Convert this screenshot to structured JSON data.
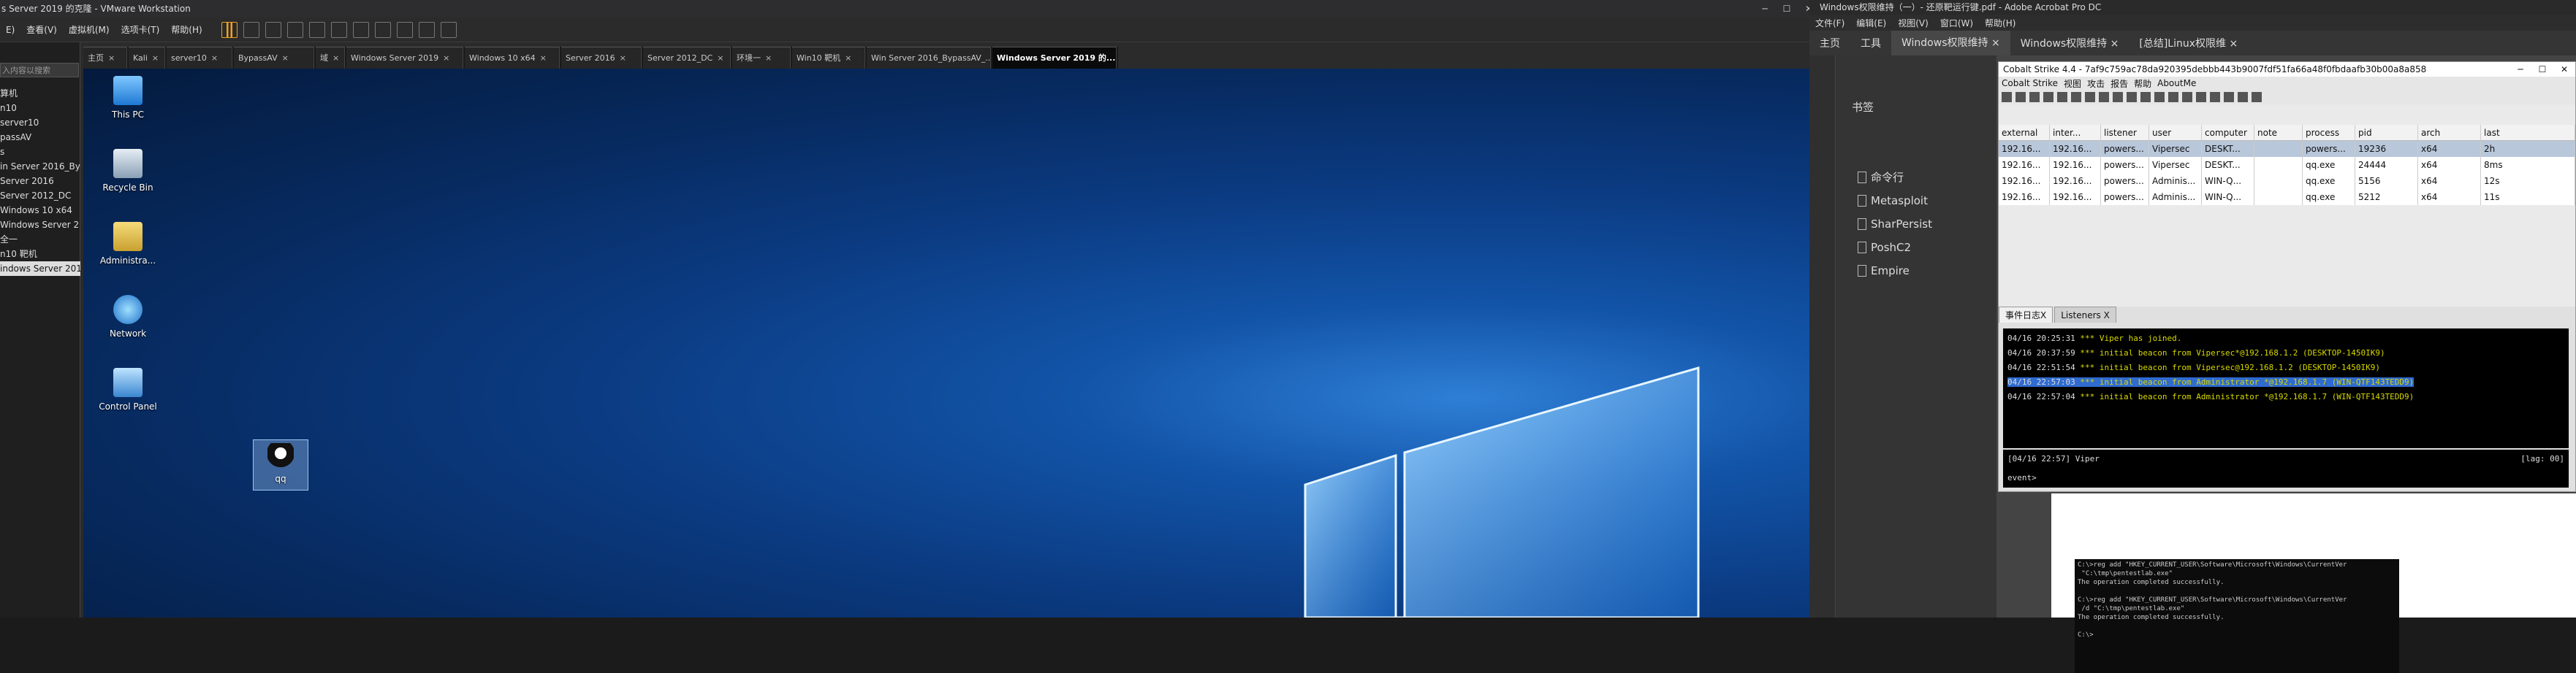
{
  "vmware": {
    "title": "s Server 2019 的克隆 - VMware Workstation",
    "menu": [
      "E)",
      "查看(V)",
      "虚拟机(M)",
      "选项卡(T)",
      "帮助(H)"
    ],
    "library_search_placeholder": "入内容以搜索",
    "library": [
      "算机",
      "n10",
      "server10",
      "passAV",
      "s",
      "in Server 2016_Bypa",
      "Server 2016",
      "Server 2012_DC",
      "Windows 10 x64",
      "Windows Server 2",
      "全一",
      "n10 靶机",
      "indows Server 2019"
    ],
    "library_selected": 12,
    "tabs": [
      "主页",
      "Kali",
      "server10",
      "BypassAV",
      "域",
      "Windows Server 2019",
      "Windows 10 x64",
      "Server 2016",
      "Server 2012_DC",
      "环境一",
      "Win10 靶机",
      "Win Server 2016_BypassAV_...",
      "Windows Server 2019 的..."
    ],
    "active_tab": 12,
    "desktop_icons": [
      "This PC",
      "Recycle Bin",
      "Administra...",
      "Network",
      "Control Panel",
      "qq"
    ]
  },
  "acrobat": {
    "title": "Windows权限维持（一）- 还原靶运行键.pdf - Adobe Acrobat Pro DC",
    "menu": [
      "文件(F)",
      "编辑(E)",
      "视图(V)",
      "窗口(W)",
      "帮助(H)"
    ],
    "tabs": [
      "主页",
      "工具",
      "Windows权限维持 ×",
      "Windows权限维持 ×",
      "[总结]Linux权限维 ×"
    ],
    "bookmarks_title": "书签",
    "bookmarks": [
      "命令行",
      "Metasploit",
      "SharPersist",
      "PoshC2",
      "Empire"
    ],
    "cmd_output": "C:\\>reg add \"HKEY_CURRENT_USER\\Software\\Microsoft\\Windows\\CurrentVer\n \"C:\\tmp\\pentestlab.exe\"\nThe operation completed successfully.\n\nC:\\>reg add \"HKEY_CURRENT_USER\\Software\\Microsoft\\Windows\\CurrentVer\n /d \"C:\\tmp\\pentestlab.exe\"\nThe operation completed successfully.\n\nC:\\>"
  },
  "cobalt": {
    "title": "Cobalt Strike 4.4 - 7af9c759ac78da920395debbb443b9007fdf51fa66a48f0fbdaafb30b00a8a858",
    "menu": [
      "Cobalt Strike",
      "视图",
      "攻击",
      "报告",
      "帮助",
      "AboutMe"
    ],
    "columns": [
      "external",
      "inter...",
      "listener",
      "user",
      "computer",
      "note",
      "process",
      "pid",
      "arch",
      "last"
    ],
    "rows": [
      [
        "192.16...",
        "192.16...",
        "powers...",
        "Vipersec",
        "DESKT...",
        "",
        "powers...",
        "19236",
        "x64",
        "2h"
      ],
      [
        "192.16...",
        "192.16...",
        "powers...",
        "Vipersec",
        "DESKT...",
        "",
        "qq.exe",
        "24444",
        "x64",
        "8ms"
      ],
      [
        "192.16...",
        "192.16...",
        "powers...",
        "Adminis...",
        "WIN-Q...",
        "",
        "qq.exe",
        "5156",
        "x64",
        "12s"
      ],
      [
        "192.16...",
        "192.16...",
        "powers...",
        "Adminis...",
        "WIN-Q...",
        "",
        "qq.exe",
        "5212",
        "x64",
        "11s"
      ]
    ],
    "bottom_tabs": [
      "事件日志X",
      "Listeners X"
    ],
    "log": [
      {
        "ts": "04/16 20:25:31",
        "msg": " *** Viper has joined."
      },
      {
        "ts": "04/16 20:37:59",
        "msg": " *** initial beacon from Vipersec*@192.168.1.2 (DESKTOP-1450IK9)"
      },
      {
        "ts": "04/16 22:51:54",
        "msg": " *** initial beacon from Vipersec@192.168.1.2 (DESKTOP-1450IK9)"
      },
      {
        "ts": "04/16 22:57:03",
        "msg": " *** initial beacon from Administrator *@192.168.1.7 (WIN-QTF143TEDD9)"
      },
      {
        "ts": "04/16 22:57:04",
        "msg": " *** initial beacon from Administrator *@192.168.1.7 (WIN-QTF143TEDD9)"
      }
    ],
    "status_left": "[04/16 22:57] Viper",
    "status_right": "[lag: 00]",
    "input": "event>"
  }
}
